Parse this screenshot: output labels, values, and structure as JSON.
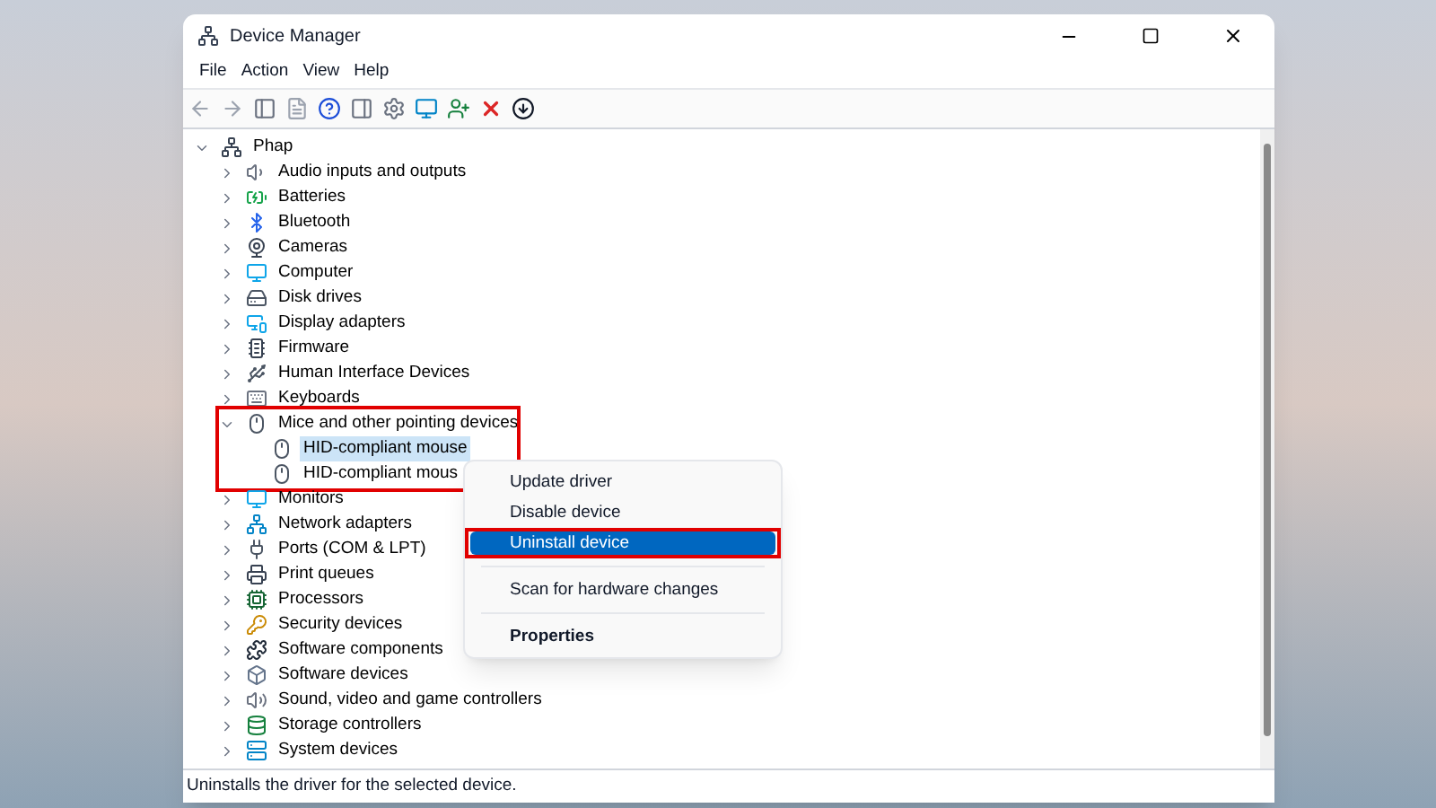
{
  "window": {
    "title": "Device Manager"
  },
  "menu_bar": [
    "File",
    "Action",
    "View",
    "Help"
  ],
  "tree": {
    "label": "Phap",
    "expanded": true,
    "children": [
      {
        "label": "Audio inputs and outputs",
        "expanded": false
      },
      {
        "label": "Batteries",
        "expanded": false
      },
      {
        "label": "Bluetooth",
        "expanded": false
      },
      {
        "label": "Cameras",
        "expanded": false
      },
      {
        "label": "Computer",
        "expanded": false
      },
      {
        "label": "Disk drives",
        "expanded": false
      },
      {
        "label": "Display adapters",
        "expanded": false
      },
      {
        "label": "Firmware",
        "expanded": false
      },
      {
        "label": "Human Interface Devices",
        "expanded": false
      },
      {
        "label": "Keyboards",
        "expanded": false
      },
      {
        "label": "Mice and other pointing devices",
        "expanded": true,
        "highlighted": true,
        "children": [
          {
            "label": "HID-compliant mouse",
            "selected": true
          },
          {
            "label": "HID-compliant mous",
            "selected": false
          }
        ]
      },
      {
        "label": "Monitors",
        "expanded": false
      },
      {
        "label": "Network adapters",
        "expanded": false
      },
      {
        "label": "Ports (COM & LPT)",
        "expanded": false
      },
      {
        "label": "Print queues",
        "expanded": false
      },
      {
        "label": "Processors",
        "expanded": false
      },
      {
        "label": "Security devices",
        "expanded": false
      },
      {
        "label": "Software components",
        "expanded": false
      },
      {
        "label": "Software devices",
        "expanded": false
      },
      {
        "label": "Sound, video and game controllers",
        "expanded": false
      },
      {
        "label": "Storage controllers",
        "expanded": false
      },
      {
        "label": "System devices",
        "expanded": false
      }
    ]
  },
  "context_menu": [
    {
      "kind": "item",
      "label": "Update driver",
      "selected": false,
      "highlighted": false,
      "default": false
    },
    {
      "kind": "item",
      "label": "Disable device",
      "selected": false,
      "highlighted": false,
      "default": false
    },
    {
      "kind": "item",
      "label": "Uninstall device",
      "selected": true,
      "highlighted": true,
      "default": false
    },
    {
      "kind": "divider"
    },
    {
      "kind": "item",
      "label": "Scan for hardware changes",
      "selected": false,
      "highlighted": false,
      "default": false
    },
    {
      "kind": "divider"
    },
    {
      "kind": "item",
      "label": "Properties",
      "selected": false,
      "highlighted": false,
      "default": true
    }
  ],
  "status_bar": "Uninstalls the driver for the selected device."
}
